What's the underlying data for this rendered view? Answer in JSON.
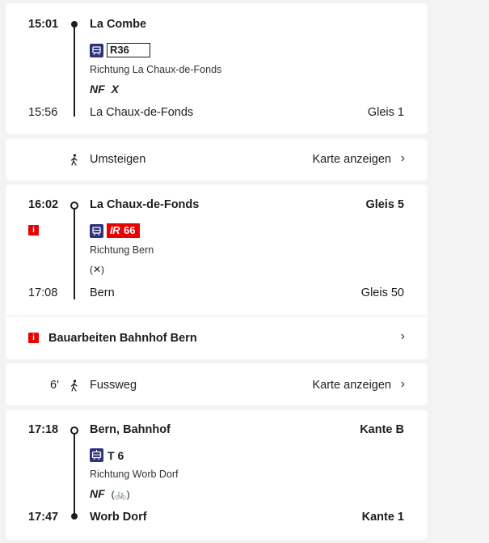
{
  "leg1": {
    "dep_time": "15:01",
    "dep_station": "La Combe",
    "line": "R36",
    "direction": "Richtung La Chaux-de-Fonds",
    "attrs": [
      "NF",
      "X"
    ],
    "arr_time": "15:56",
    "arr_station": "La Chaux-de-Fonds",
    "arr_platform": "Gleis 1"
  },
  "transfer": {
    "label": "Umsteigen",
    "map_link": "Karte anzeigen"
  },
  "leg2": {
    "dep_time": "16:02",
    "dep_station": "La Chaux-de-Fonds",
    "dep_platform": "Gleis 5",
    "line_prefix": "IR",
    "line_number": "66",
    "direction": "Richtung Bern",
    "attrs": [
      "(✕)"
    ],
    "arr_time": "17:08",
    "arr_station": "Bern",
    "arr_platform": "Gleis 50",
    "notice": "Bauarbeiten Bahnhof Bern"
  },
  "walk": {
    "duration": "6'",
    "label": "Fussweg",
    "map_link": "Karte anzeigen"
  },
  "leg3": {
    "dep_time": "17:18",
    "dep_station": "Bern, Bahnhof",
    "dep_platform": "Kante B",
    "line": "T 6",
    "direction": "Richtung Worb Dorf",
    "attrs": [
      "NF",
      "(🚲)"
    ],
    "arr_time": "17:47",
    "arr_station": "Worb Dorf",
    "arr_platform": "Kante 1"
  },
  "icons": {
    "train": "train-icon",
    "tram": "tram-icon",
    "walk": "walking-person-icon",
    "info": "info-icon",
    "chevron": "chevron-right-icon"
  },
  "colors": {
    "sbb_red": "#eb0000",
    "transport_blue": "#2d327d",
    "text": "#1d1d1d"
  }
}
